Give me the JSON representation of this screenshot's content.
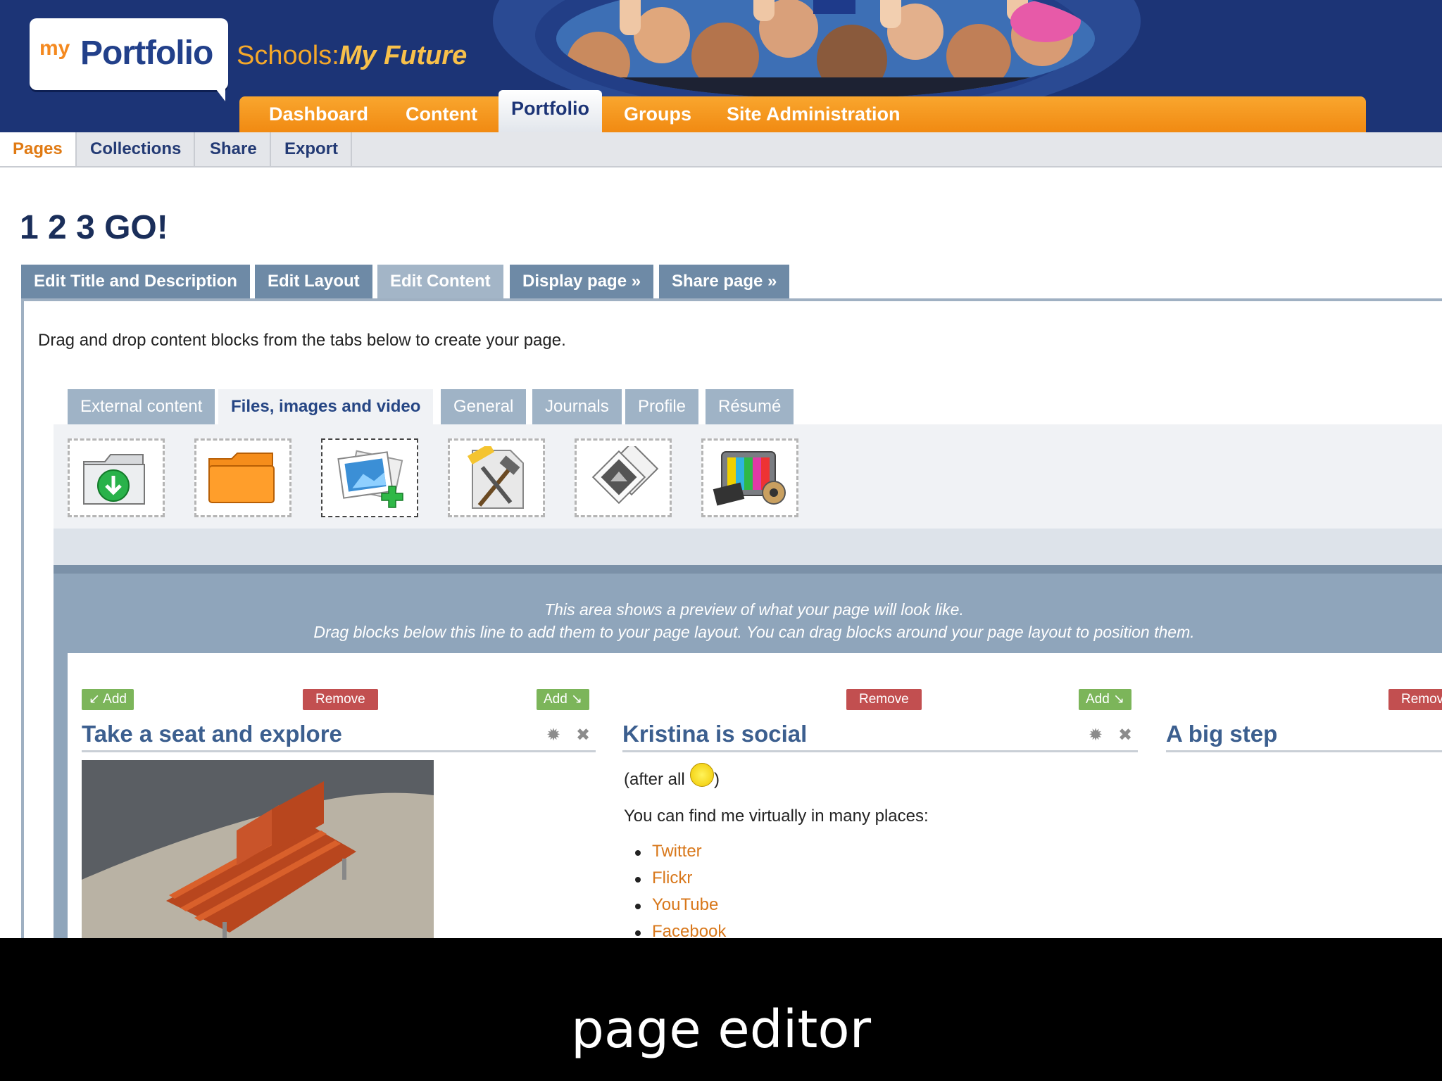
{
  "brand": {
    "logo_my": "my",
    "logo_portfolio": "Portfolio",
    "tagline_prefix": "Schools:",
    "tagline_suffix": "My Future"
  },
  "main_nav": [
    "Dashboard",
    "Content",
    "Portfolio",
    "Groups",
    "Site Administration"
  ],
  "sub_nav": [
    "Pages",
    "Collections",
    "Share",
    "Export"
  ],
  "page_title": "1 2 3 GO!",
  "edit_tabs": [
    "Edit Title and Description",
    "Edit Layout",
    "Edit Content",
    "Display page »",
    "Share page »"
  ],
  "instructions": "Drag and drop content blocks from the tabs below to create your page.",
  "block_tabs": [
    "External content",
    "Files, images and video",
    "General",
    "Journals",
    "Profile",
    "Résumé"
  ],
  "palette_icons": [
    "file-download-icon",
    "folder-icon",
    "image-add-icon",
    "html-icon",
    "image-gallery-icon",
    "media-player-icon"
  ],
  "preview": {
    "line1": "This area shows a preview of what your page will look like.",
    "line2": "Drag blocks below this line to add them to your page layout. You can drag blocks around your page layout to position them."
  },
  "columns": {
    "add_label": "Add",
    "remove_label": "Remove",
    "remove_clipped": "Remov"
  },
  "blocks": [
    {
      "title": "Take a seat and explore"
    },
    {
      "title": "Kristina is social",
      "line1": "(after all",
      "line1_end": ")",
      "line2": "You can find me virtually in many places:",
      "links": [
        "Twitter",
        "Flickr",
        "YouTube",
        "Facebook"
      ]
    },
    {
      "title": "A big step"
    }
  ],
  "caption": "page editor",
  "colors": {
    "header": "#1c3476",
    "nav_orange": "#f18a12",
    "link": "#d8771a",
    "add": "#7cb55a",
    "remove": "#c24f50"
  }
}
